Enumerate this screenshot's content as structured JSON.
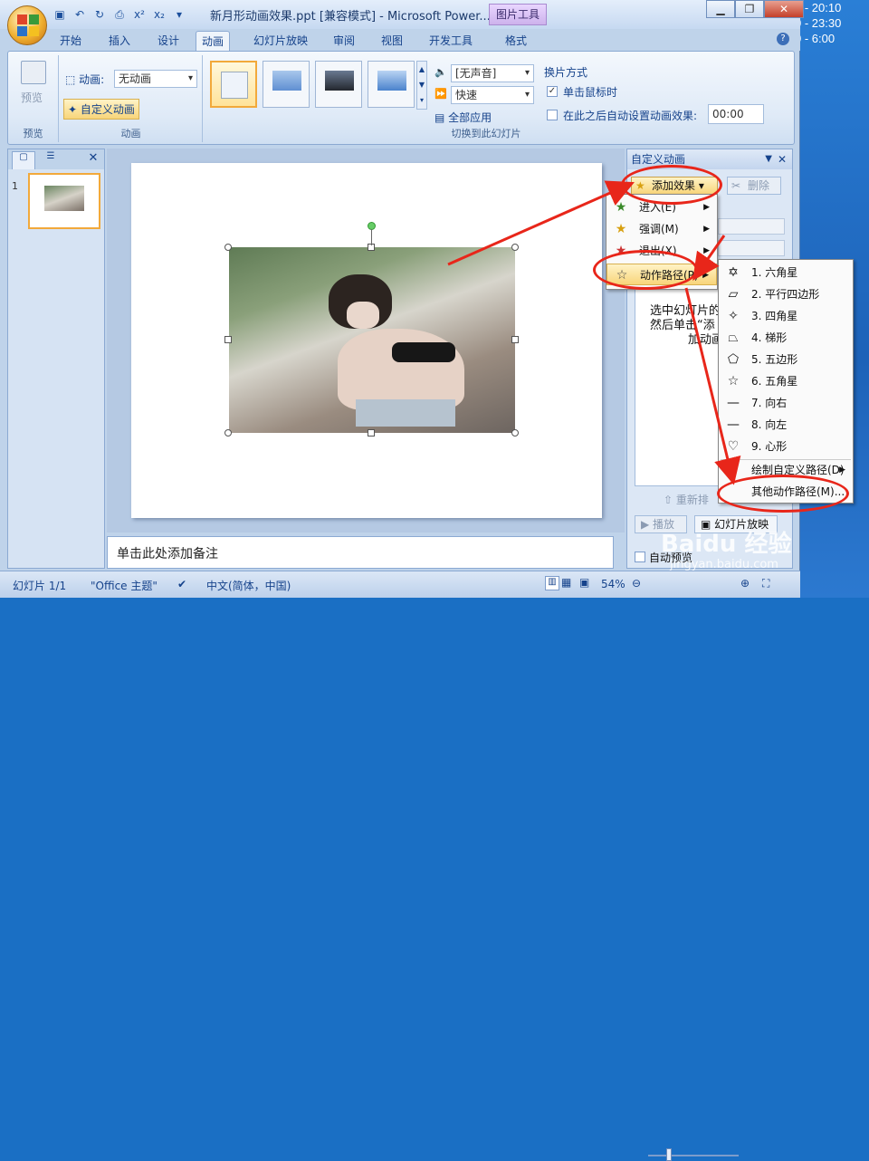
{
  "clock": {
    "line1": "0 - 23:30",
    "line2": "0 -  6:00"
  },
  "window": {
    "title": "新月形动画效果.ppt [兼容模式] - Microsoft Power...",
    "context_tab": "图片工具",
    "tabs": [
      "开始",
      "插入",
      "设计",
      "动画",
      "幻灯片放映",
      "审阅",
      "视图",
      "开发工具",
      "格式"
    ],
    "active_tab": "动画"
  },
  "ribbon": {
    "preview": {
      "label": "预览",
      "group": "预览"
    },
    "animation": {
      "anim_label": "动画:",
      "anim_value": "无动画",
      "custom_anim": "自定义动画",
      "group": "动画"
    },
    "transition": {
      "sound": "[无声音]",
      "speed": "快速",
      "apply_all": "全部应用",
      "mode_title": "换片方式",
      "on_click": "单击鼠标时",
      "auto_after": "在此之后自动设置动画效果:",
      "auto_time": "00:00",
      "group": "切换到此幻灯片"
    }
  },
  "slides_panel": {
    "slide_number": "1"
  },
  "notes": {
    "placeholder": "单击此处添加备注"
  },
  "custom_anim_panel": {
    "title": "自定义动画",
    "add_effect": "添加效果",
    "delete": "删除",
    "hint_line1": "选中幻灯片的某",
    "hint_line2": "然后单击“添",
    "hint_line3": "加动画",
    "reorder": "重新排",
    "play": "播放",
    "slideshow": "幻灯片放映",
    "autopreview": "自动预览"
  },
  "add_effect_menu": [
    {
      "label": "进入(E)",
      "icon": "★"
    },
    {
      "label": "强调(M)",
      "icon": "★"
    },
    {
      "label": "退出(X)",
      "icon": "★"
    },
    {
      "label": "动作路径(P)",
      "icon": "☆"
    }
  ],
  "motion_path_menu": [
    {
      "label": "1. 六角星",
      "icon": "✡"
    },
    {
      "label": "2. 平行四边形",
      "icon": "▱"
    },
    {
      "label": "3. 四角星",
      "icon": "✧"
    },
    {
      "label": "4. 梯形",
      "icon": "⏢"
    },
    {
      "label": "5. 五边形",
      "icon": "⬠"
    },
    {
      "label": "6. 五角星",
      "icon": "☆"
    },
    {
      "label": "7. 向右",
      "icon": "—"
    },
    {
      "label": "8. 向左",
      "icon": "—"
    },
    {
      "label": "9. 心形",
      "icon": "♡"
    },
    {
      "label": "绘制自定义路径(D)",
      "icon": "∿"
    },
    {
      "label": "其他动作路径(M)...",
      "icon": ""
    }
  ],
  "status": {
    "slide": "幻灯片 1/1",
    "theme": "\"Office 主题\"",
    "lang": "中文(简体，中国)",
    "zoom": "54%"
  },
  "watermark": {
    "brand": "Baidu 经验",
    "url": "jingyan.baidu.com"
  },
  "colors": {
    "accent": "#e8261a",
    "ribbon": "#dfeaf7",
    "frame": "#bfd3ea"
  }
}
